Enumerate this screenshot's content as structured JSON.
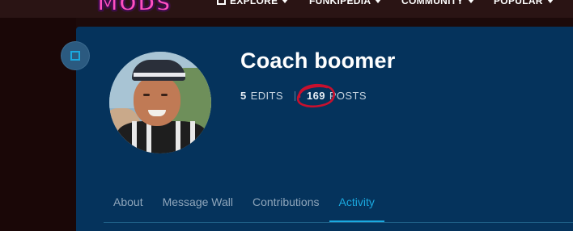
{
  "header": {
    "logo_text": "MODS",
    "nav": [
      {
        "label": "EXPLORE",
        "icon": "explore-icon"
      },
      {
        "label": "FUNKIPEDIA"
      },
      {
        "label": "COMMUNITY"
      },
      {
        "label": "POPULAR"
      }
    ]
  },
  "profile": {
    "username": "Coach boomer",
    "stats": {
      "edits_count": "5",
      "edits_label": "EDITS",
      "posts_count": "169",
      "posts_label": "POSTS"
    }
  },
  "tabs": [
    {
      "label": "About",
      "active": false
    },
    {
      "label": "Message Wall",
      "active": false
    },
    {
      "label": "Contributions",
      "active": false
    },
    {
      "label": "Activity",
      "active": true
    }
  ],
  "colors": {
    "panel_bg": "#05335c",
    "accent": "#1aa9e0",
    "annotation": "#c8102e",
    "logo": "#ff4fbf"
  }
}
